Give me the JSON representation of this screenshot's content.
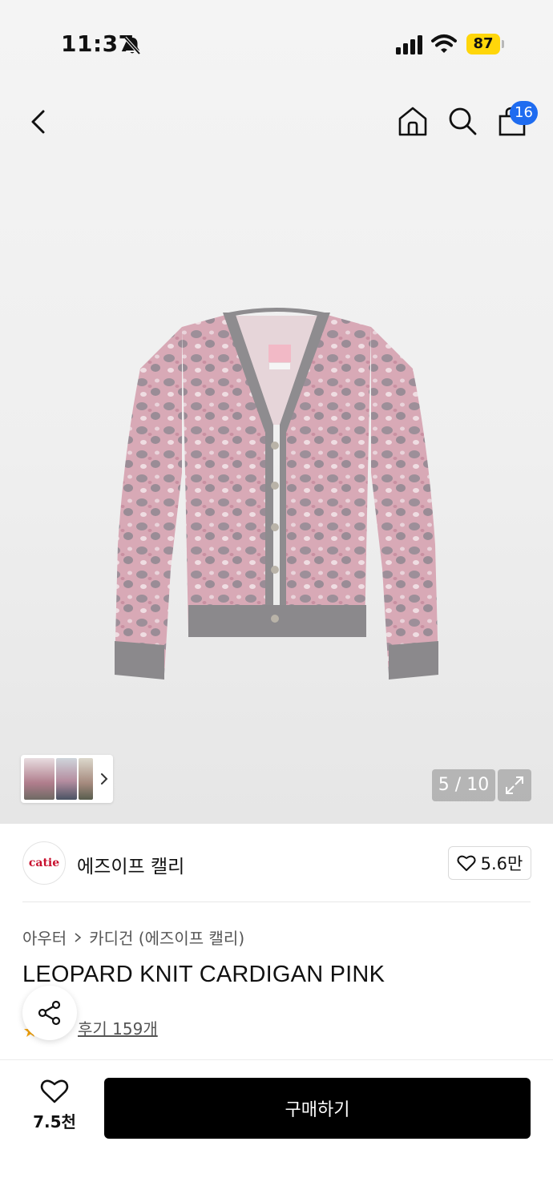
{
  "status_bar": {
    "time": "11:37",
    "battery": "87",
    "icons": [
      "bell-off-icon",
      "signal-icon",
      "wifi-icon",
      "battery-icon"
    ],
    "battery_color": "#ffd60a"
  },
  "nav": {
    "icons": [
      "chevron-left-icon",
      "home-icon",
      "search-icon",
      "shopping-bag-icon"
    ],
    "cart_badge": "16",
    "badge_color": "#1f6cf0"
  },
  "gallery": {
    "pager": "5 / 10",
    "expand_icon": "expand-icon"
  },
  "brand": {
    "logo_text": "catie",
    "name": "에즈이프 캘리",
    "likes": "5.6만"
  },
  "breadcrumb": {
    "category": "아우터",
    "subcategory": "카디건 (에즈이프 캘리)"
  },
  "product": {
    "title": "LEOPARD KNIT CARDIGAN PINK",
    "reviews": "후기 159개"
  },
  "bottom_bar": {
    "wish_count": "7.5천",
    "buy_label": "구매하기"
  }
}
